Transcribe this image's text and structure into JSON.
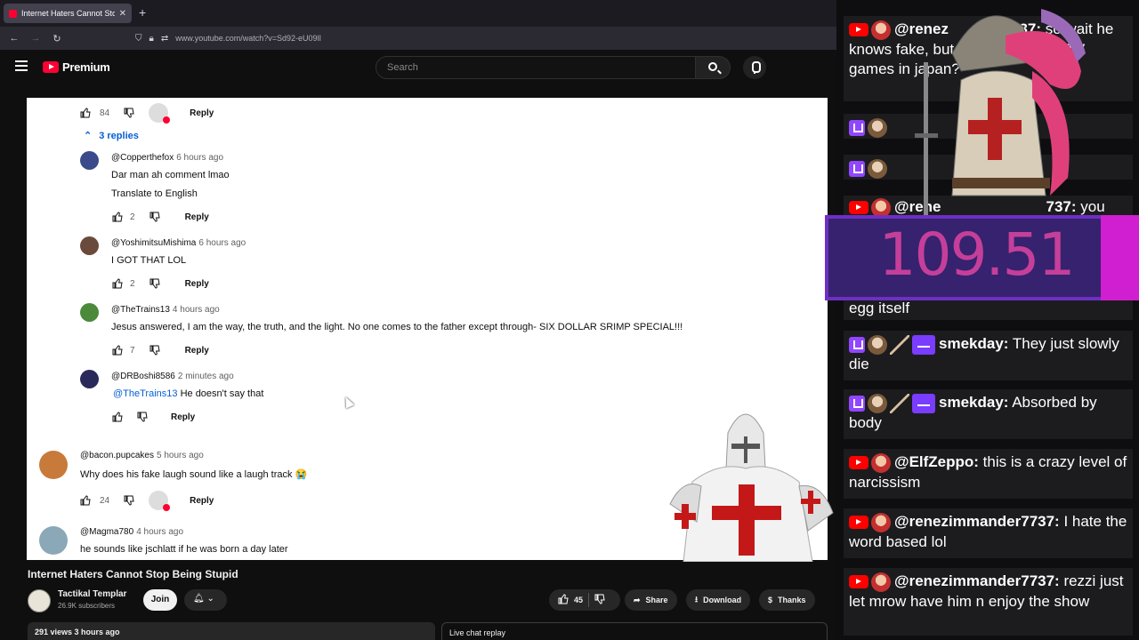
{
  "browser": {
    "tab_title": "Internet Haters Cannot Stop Being Stupid",
    "new_tab": "+",
    "url": "www.youtube.com/watch?v=Sd92-eU09lI"
  },
  "header": {
    "logo_text": "Premium",
    "search_placeholder": "Search"
  },
  "comments": {
    "top_like_count": "84",
    "top_reply": "Reply",
    "replies_toggle": "3 replies",
    "items": [
      {
        "user": "@Copperthefox",
        "time": "6 hours ago",
        "text": "Dar man ah comment lmao",
        "extra": "Translate to English",
        "likes": "2",
        "reply": "Reply"
      },
      {
        "user": "@YoshimitsuMishima",
        "time": "6 hours ago",
        "text": "I GOT THAT LOL",
        "likes": "2",
        "reply": "Reply"
      },
      {
        "user": "@TheTrains13",
        "time": "4 hours ago",
        "text": "Jesus answered, I am the way, the truth, and the light. No one comes to the father except through- SIX DOLLAR SRIMP SPECIAL!!!",
        "likes": "7",
        "reply": "Reply"
      },
      {
        "user": "@DRBoshi8586",
        "time": "2 minutes ago",
        "mention": "@TheTrains13",
        "text": " He doesn't say that",
        "likes": "",
        "reply": "Reply"
      },
      {
        "user": "@bacon.pupcakes",
        "time": "5 hours ago",
        "text": "Why does his fake laugh sound like a laugh track 😭",
        "likes": "24",
        "reply": "Reply"
      },
      {
        "user": "@Magma780",
        "time": "4 hours ago",
        "text": "he sounds like jschlatt if he was born a day later"
      }
    ]
  },
  "video": {
    "title": "Internet Haters Cannot Stop Being Stupid",
    "channel": "Tactikal Templar",
    "subscribers": "26.9K subscribers",
    "join": "Join",
    "likes": "45",
    "share": "Share",
    "download": "Download",
    "thanks": "Thanks",
    "meta": "291 views  3 hours ago",
    "live_chat": "Live chat replay"
  },
  "overlay": {
    "counter": "109.51",
    "messages": [
      {
        "platform": "youtube",
        "author": "@renez",
        "author_tail": "737:",
        "text": " so wait he knows     fake, but he thinks trump        TV games in japan?"
      },
      {
        "platform": "youtube",
        "author": "@rene",
        "author_tail": "737:",
        "text": " you"
      },
      {
        "platform": "none",
        "author": "",
        "text": "egg itself"
      },
      {
        "platform": "twitch",
        "author": "smekday:",
        "text": " They just slowly die"
      },
      {
        "platform": "twitch",
        "author": "smekday:",
        "text": " Absorbed by body"
      },
      {
        "platform": "youtube",
        "author": "@ElfZeppo:",
        "text": " this is a crazy level of narcissism"
      },
      {
        "platform": "youtube",
        "author": "@renezimmander7737:",
        "text": " I hate the word based lol"
      },
      {
        "platform": "youtube",
        "author": "@renezimmander7737:",
        "text": " rezzi just let mrow have him n enjoy the show"
      }
    ]
  },
  "colors": {
    "youtube_red": "#ff0033",
    "link_blue": "#065fd4",
    "twitch_purple": "#9146ff",
    "counter_pink": "#c53f9a"
  }
}
